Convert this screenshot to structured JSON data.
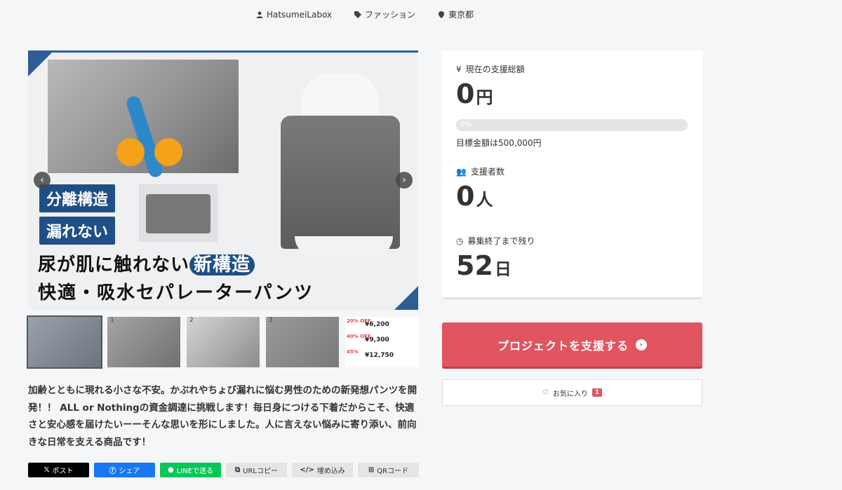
{
  "meta": {
    "user": "HatsumeiLabox",
    "category": "ファッション",
    "location": "東京都"
  },
  "hero": {
    "tag1": "分離構造",
    "tag2": "漏れない",
    "headline1_pre": "尿が肌に触れない",
    "headline1_hl": "新構造",
    "headline2": "快適・吸水セパレーターパンツ"
  },
  "thumbnails": [
    {
      "num": "",
      "label": "main"
    },
    {
      "num": "1",
      "label": "photo-1"
    },
    {
      "num": "2",
      "label": "photo-2"
    },
    {
      "num": "3",
      "label": "photo-3"
    },
    {
      "num": "",
      "label": "price-table"
    }
  ],
  "price_table": [
    {
      "off": "20%\nOFF",
      "price": "¥6,200"
    },
    {
      "off": "40%\nOFF",
      "price": "¥9,300"
    },
    {
      "off": "45%",
      "price": "¥12,750"
    }
  ],
  "description": "加齢とともに現れる小さな不安。かぶれやちょび漏れに悩む男性のための新発想パンツを開発！！ ALL or Nothingの資金調達に挑戦します！毎日身につける下着だからこそ、快適さと安心感を届けたいーーそんな思いを形にしました。人に言えない悩みに寄り添い、前向きな日常を支える商品です！",
  "share": {
    "x": "ポスト",
    "facebook": "シェア",
    "line": "LINEで送る",
    "url": "URLコピー",
    "embed": "埋め込み",
    "qr": "QRコード"
  },
  "stats": {
    "total_label": "現在の支援総額",
    "total_value": "0",
    "total_unit": "円",
    "progress_percent": 0,
    "progress_text": "0%",
    "goal_text": "目標金額は500,000円",
    "supporters_label": "支援者数",
    "supporters_value": "0",
    "supporters_unit": "人",
    "remaining_label": "募集終了まで残り",
    "remaining_value": "52",
    "remaining_unit": "日"
  },
  "cta": {
    "label": "プロジェクトを支援する"
  },
  "favorite": {
    "label": "お気に入り",
    "count": "1"
  },
  "colors": {
    "accent": "#e05560",
    "hero_blue": "#1f4f86"
  }
}
